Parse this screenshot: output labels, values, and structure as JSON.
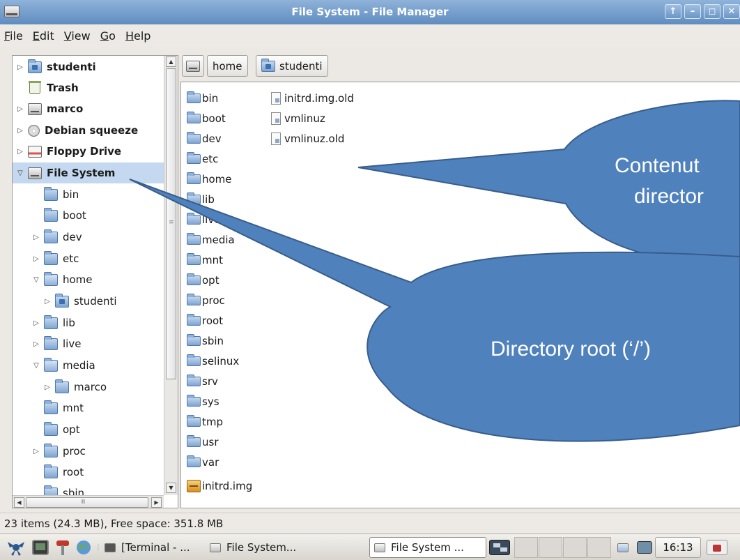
{
  "window": {
    "title": "File System - File Manager"
  },
  "menu": {
    "file": "File",
    "edit": "Edit",
    "view": "View",
    "go": "Go",
    "help": "Help"
  },
  "tree": {
    "items": [
      {
        "label": "studenti",
        "expander": "▷"
      },
      {
        "label": "Trash",
        "expander": ""
      },
      {
        "label": "marco",
        "expander": "▷"
      },
      {
        "label": "Debian squeeze",
        "expander": "▷"
      },
      {
        "label": "Floppy Drive",
        "expander": "▷"
      },
      {
        "label": "File System",
        "expander": "▽"
      },
      {
        "label": "bin",
        "expander": ""
      },
      {
        "label": "boot",
        "expander": ""
      },
      {
        "label": "dev",
        "expander": "▷"
      },
      {
        "label": "etc",
        "expander": "▷"
      },
      {
        "label": "home",
        "expander": "▽"
      },
      {
        "label": "studenti",
        "expander": "▷"
      },
      {
        "label": "lib",
        "expander": "▷"
      },
      {
        "label": "live",
        "expander": "▷"
      },
      {
        "label": "media",
        "expander": "▽"
      },
      {
        "label": "marco",
        "expander": "▷"
      },
      {
        "label": "mnt",
        "expander": ""
      },
      {
        "label": "opt",
        "expander": ""
      },
      {
        "label": "proc",
        "expander": "▷"
      },
      {
        "label": "root",
        "expander": ""
      },
      {
        "label": "sbin",
        "expander": ""
      }
    ]
  },
  "pathbar": {
    "home": "home",
    "studenti": "studenti"
  },
  "main": {
    "col1": [
      "bin",
      "boot",
      "dev",
      "etc",
      "home",
      "lib",
      "live",
      "media",
      "mnt",
      "opt",
      "proc",
      "root",
      "sbin",
      "selinux",
      "srv",
      "sys",
      "tmp",
      "usr",
      "var",
      "initrd.img"
    ],
    "col2": [
      "initrd.img.old",
      "vmlinuz",
      "vmlinuz.old"
    ]
  },
  "status": {
    "text": "23 items (24.3 MB), Free space: 351.8 MB"
  },
  "taskbar": {
    "terminal": "[Terminal - ...",
    "fs1": "File System...",
    "fs2": "File System ...",
    "clock": "16:13"
  },
  "callouts": {
    "contents": "Contenut",
    "contents2": "director",
    "root": "Directory root (‘/’)"
  },
  "colors": {
    "callout_fill": "#4f81bd",
    "callout_stroke": "#385d8a",
    "selection": "#c4d8ef"
  }
}
